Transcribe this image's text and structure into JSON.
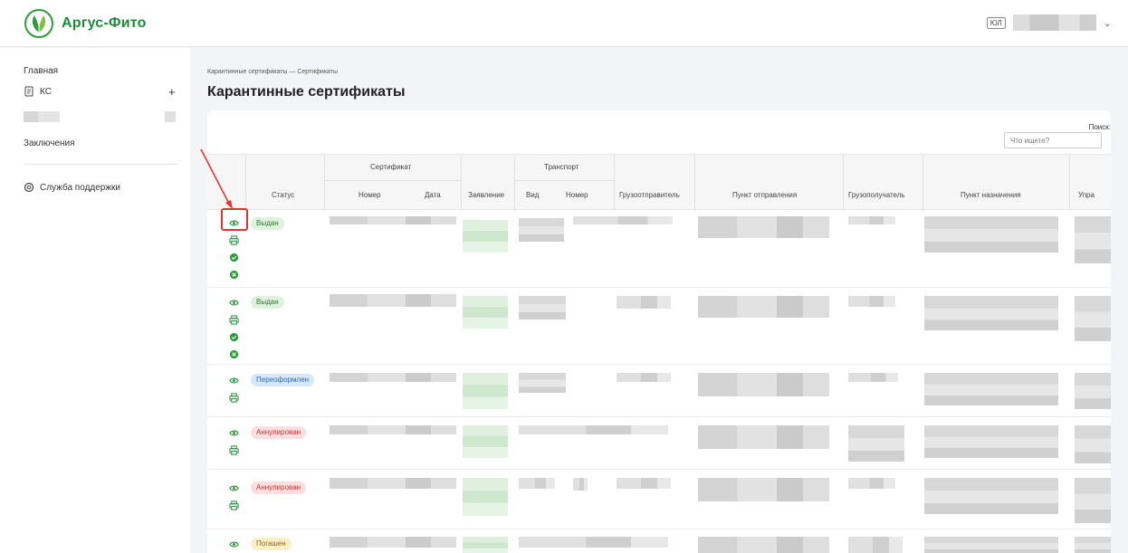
{
  "app": {
    "name": "Аргус-Фито",
    "org_badge": "ЮЛ"
  },
  "sidebar": {
    "items": [
      {
        "label": "Главная"
      },
      {
        "label": "КС"
      },
      {
        "label": "Заключения"
      },
      {
        "label": "Служба поддержки"
      }
    ]
  },
  "breadcrumb": "Карантинные сертификаты — Сертификаты",
  "page_title": "Карантинные сертификаты",
  "search": {
    "label": "Поиск:",
    "placeholder": "Что ищете?"
  },
  "table": {
    "groups": {
      "certificate": "Сертификат",
      "transport": "Транспорт"
    },
    "columns": {
      "status": "Статус",
      "number": "Номер",
      "date": "Дата",
      "application": "Заявление",
      "kind": "Вид",
      "transport_number": "Номер",
      "shipper": "Грузоотправитель",
      "departure": "Пункт отправления",
      "consignee": "Грузополучатель",
      "destination": "Пункт назначения",
      "manage": "Упра"
    },
    "rows": [
      {
        "status": "Выдан",
        "status_color": "green",
        "actions": [
          "eye-icon",
          "printer-icon",
          "check-circle-icon",
          "close-circle-icon"
        ]
      },
      {
        "status": "Выдан",
        "status_color": "green",
        "actions": [
          "eye-icon",
          "printer-icon",
          "check-circle-icon",
          "close-circle-icon"
        ]
      },
      {
        "status": "Переоформлен",
        "status_color": "blue",
        "actions": [
          "eye-icon",
          "printer-icon"
        ]
      },
      {
        "status": "Аннулирован",
        "status_color": "red",
        "actions": [
          "eye-icon",
          "printer-icon"
        ]
      },
      {
        "status": "Аннулирован",
        "status_color": "red",
        "actions": [
          "eye-icon",
          "printer-icon"
        ]
      },
      {
        "status": "Погашен",
        "status_color": "yellow",
        "actions": [
          "eye-icon"
        ]
      }
    ]
  },
  "colors": {
    "brand": "#1f8a3a",
    "action_icon": "#2e9b3e",
    "highlight": "#e0352b"
  }
}
